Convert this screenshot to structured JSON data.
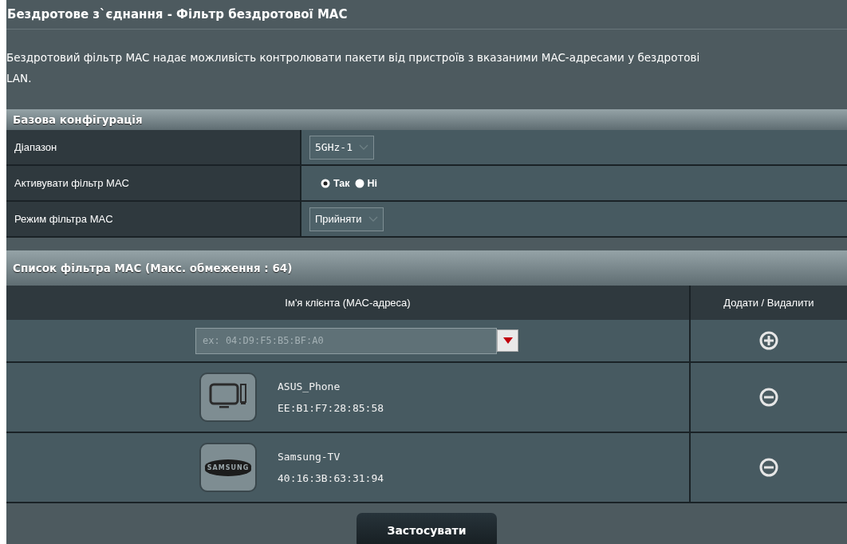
{
  "page": {
    "title": "Бездротове з`єднання - Фільтр бездротової MAC",
    "description": [
      "Бездротовий фільтр MAC надає можливість контролювати пакети від пристроїв з вказаними MAC-адресами у бездротові",
      "LAN."
    ]
  },
  "basic_config": {
    "header": "Базова конфігурація",
    "rows": [
      {
        "kind": "select",
        "label": "Діапазон",
        "value": "5GHz-1"
      },
      {
        "kind": "radio",
        "label": "Активувати фільтр MAC",
        "options": [
          {
            "label": "Так",
            "selected": true
          },
          {
            "label": "Ні",
            "selected": false
          }
        ]
      },
      {
        "kind": "select",
        "label": "Режим фільтра MAC",
        "value": "Прийняти"
      }
    ]
  },
  "filter_list": {
    "header": "Список фільтра MAC (Макс. обмеження : 64)",
    "columns": [
      "Ім'я клієнта (MAC-адреса)",
      "Додати / Видалити"
    ],
    "input": {
      "placeholder": "ex: 04:D9:F5:B5:BF:A0"
    },
    "clients": [
      {
        "kind": "computer",
        "name": "ASUS_Phone",
        "mac": "EE:B1:F7:28:85:58"
      },
      {
        "kind": "logo",
        "logo_text": "SAMSUNG",
        "name": "Samsung-TV",
        "mac": "40:16:3B:63:31:94"
      }
    ]
  },
  "buttons": [
    "Застосувати"
  ]
}
